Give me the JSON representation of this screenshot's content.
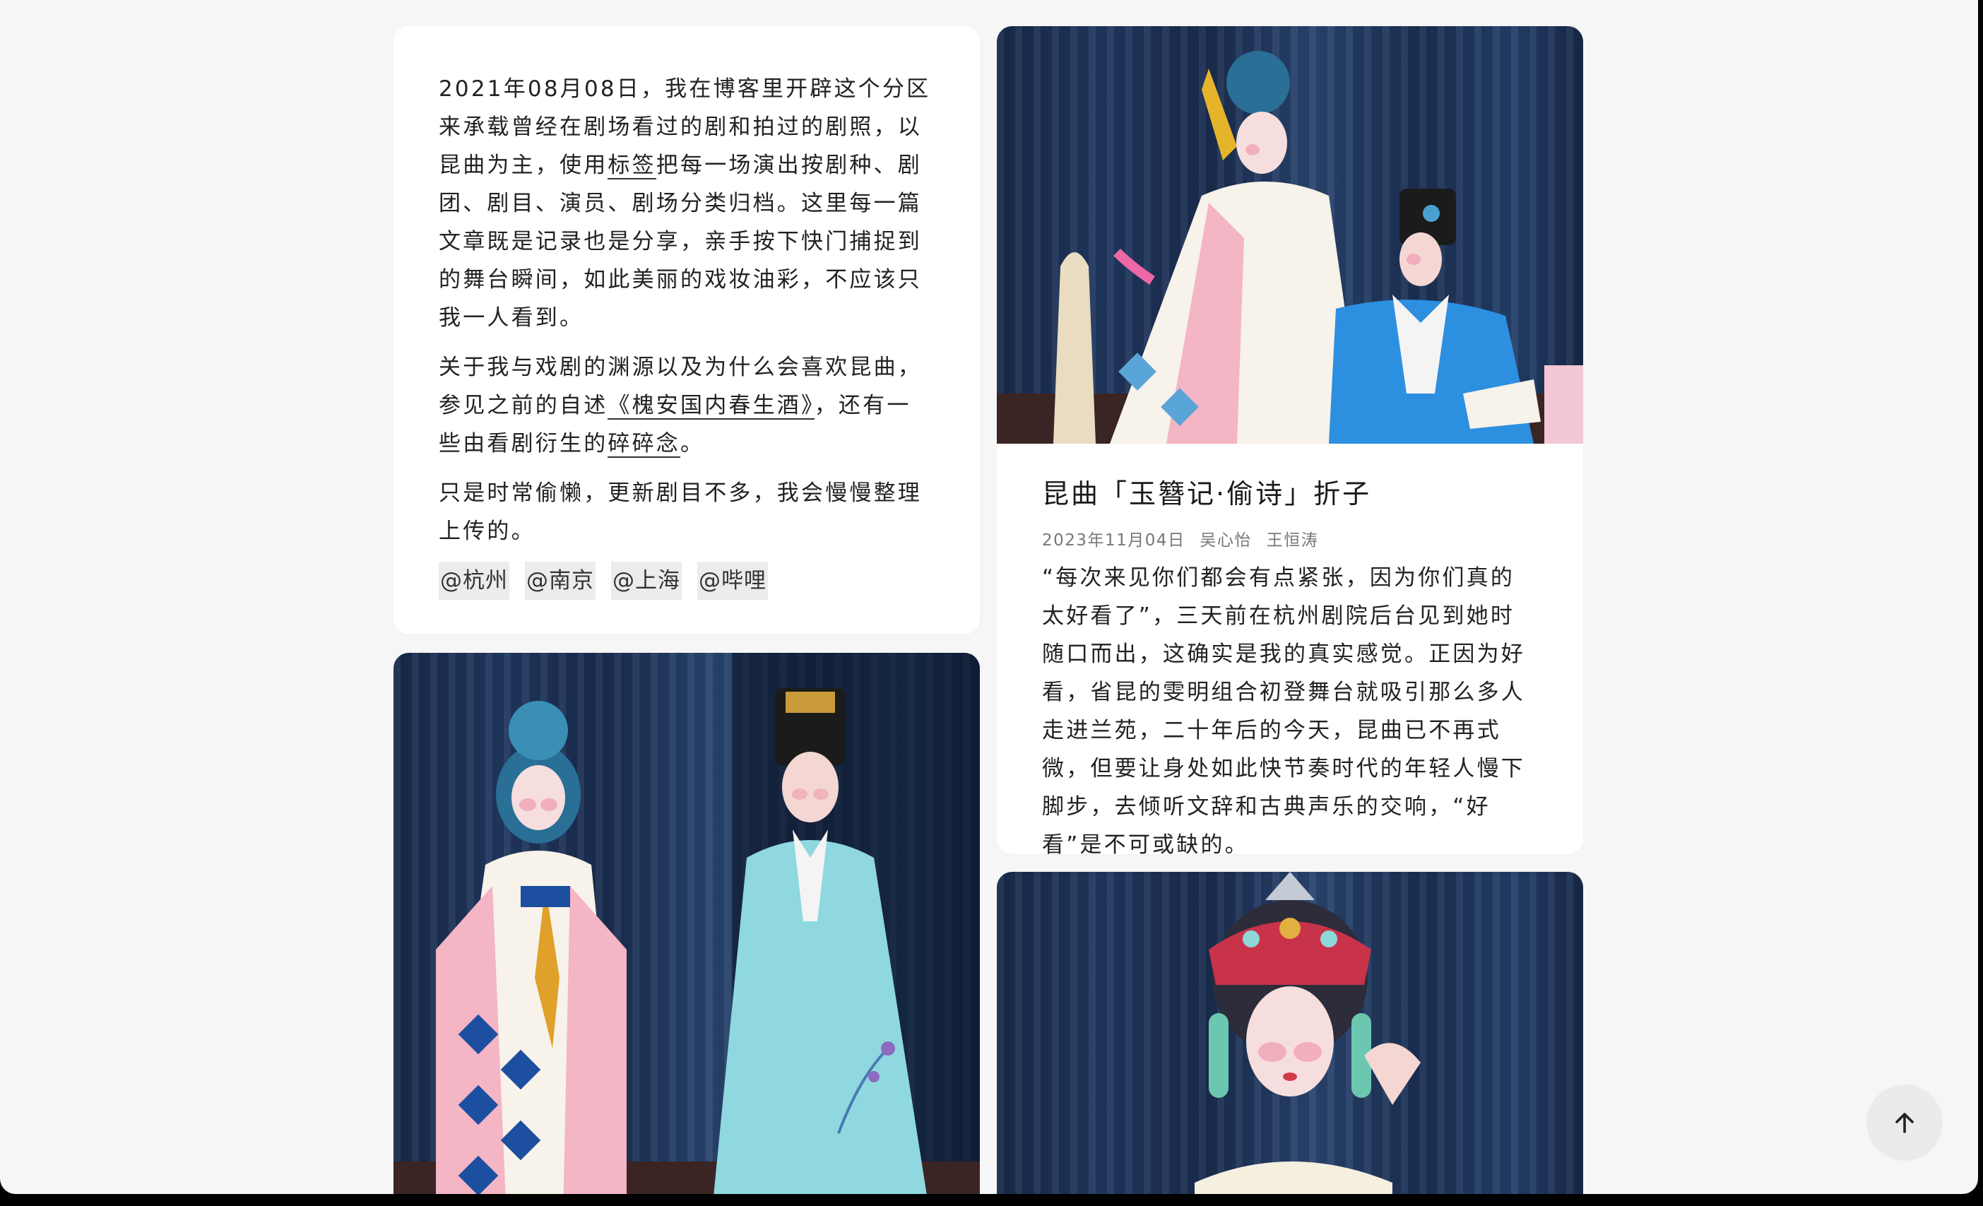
{
  "intro": {
    "p1_before": "2021年08月08日，我在博客里开辟这个分区来承载曾经在剧场看过的剧和拍过的剧照，以昆曲为主，使用",
    "tags_link": "标签",
    "p1_after": "把每一场演出按剧种、剧团、剧目、演员、剧场分类归档。这里每一篇文章既是记录也是分享，亲手按下快门捕捉到的舞台瞬间，如此美丽的戏妆油彩，不应该只我一人看到。",
    "p2_before": "关于我与戏剧的渊源以及为什么会喜欢昆曲，参见之前的自述",
    "p2_link": "《槐安国内春生酒》",
    "p2_middle": "，还有一些由看剧衍生的",
    "p2_link2": "碎碎念",
    "p2_after": "。",
    "p3": "只是时常偷懒，更新剧目不多，我会慢慢整理上传的。",
    "social": [
      "@杭州",
      "@南京",
      "@上海",
      "@哔哩"
    ]
  },
  "post": {
    "title": "昆曲「玉簪记·偷诗」折子",
    "date": "2023年11月04日",
    "performers": [
      "吴心怡",
      "王恒涛"
    ],
    "excerpt": "“每次来见你们都会有点紧张，因为你们真的太好看了”，三天前在杭州剧院后台见到她时随口而出，这确实是我的真实感觉。正因为好看，省昆的雯明组合初登舞台就吸引那么多人走进兰苑，二十年后的今天，昆曲已不再式微，但要让身处如此快节奏时代的年轻人慢下脚步，去倾听文辞和古典声乐的交响，“好看”是不可或缺的。"
  },
  "colors": {
    "page_bg": "#f6f6f6",
    "card_bg": "#ffffff",
    "stage_blue": "#213860"
  },
  "icons": {
    "scroll_top": "arrow-up-icon"
  }
}
